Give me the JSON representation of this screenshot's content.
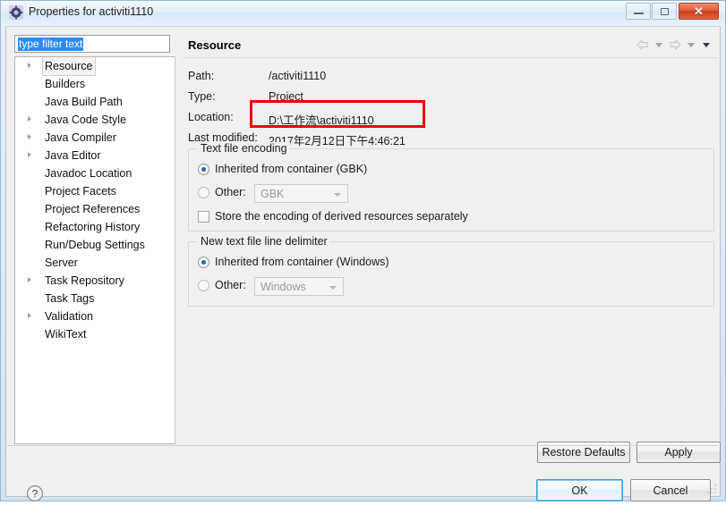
{
  "window": {
    "title": "Properties for activiti1110",
    "icon": "properties-gear-icon",
    "controls": {
      "minimize": "Minimize",
      "maximize": "Maximize",
      "close": "Close"
    }
  },
  "filter": {
    "value": "type filter text",
    "placeholder": "type filter text"
  },
  "tree": {
    "items": [
      {
        "label": "Resource",
        "expandable": true,
        "selected": true
      },
      {
        "label": "Builders",
        "expandable": false,
        "selected": false
      },
      {
        "label": "Java Build Path",
        "expandable": false,
        "selected": false
      },
      {
        "label": "Java Code Style",
        "expandable": true,
        "selected": false
      },
      {
        "label": "Java Compiler",
        "expandable": true,
        "selected": false
      },
      {
        "label": "Java Editor",
        "expandable": true,
        "selected": false
      },
      {
        "label": "Javadoc Location",
        "expandable": false,
        "selected": false
      },
      {
        "label": "Project Facets",
        "expandable": false,
        "selected": false
      },
      {
        "label": "Project References",
        "expandable": false,
        "selected": false
      },
      {
        "label": "Refactoring History",
        "expandable": false,
        "selected": false
      },
      {
        "label": "Run/Debug Settings",
        "expandable": false,
        "selected": false
      },
      {
        "label": "Server",
        "expandable": false,
        "selected": false
      },
      {
        "label": "Task Repository",
        "expandable": true,
        "selected": false
      },
      {
        "label": "Task Tags",
        "expandable": false,
        "selected": false
      },
      {
        "label": "Validation",
        "expandable": true,
        "selected": false
      },
      {
        "label": "WikiText",
        "expandable": false,
        "selected": false
      }
    ]
  },
  "page": {
    "title": "Resource",
    "nav": {
      "back": "back-arrow-icon",
      "back_menu": "back-dropdown-icon",
      "forward": "forward-arrow-icon",
      "forward_menu": "forward-dropdown-icon",
      "view_menu": "view-menu-icon"
    },
    "info": [
      {
        "label": "Path:",
        "value": "/activiti1110"
      },
      {
        "label": "Type:",
        "value": "Project"
      },
      {
        "label": "Location:",
        "value": "D:\\工作流\\activiti1110"
      },
      {
        "label": "Last modified:",
        "value": "2017年2月12日下午4:46:21"
      }
    ],
    "annotation": {
      "color": "#ee0000",
      "target": "Location value"
    },
    "encoding_group": {
      "title": "Text file encoding",
      "inherited": {
        "label": "Inherited from container (GBK)",
        "checked": true
      },
      "other": {
        "label": "Other:",
        "checked": false,
        "value": "GBK",
        "enabled": false
      },
      "store_derived": {
        "label": "Store the encoding of derived resources separately",
        "checked": false
      }
    },
    "delimiter_group": {
      "title": "New text file line delimiter",
      "inherited": {
        "label": "Inherited from container (Windows)",
        "checked": true
      },
      "other": {
        "label": "Other:",
        "checked": false,
        "value": "Windows",
        "enabled": false
      }
    },
    "buttons": {
      "restore_defaults": "Restore Defaults",
      "apply": "Apply"
    }
  },
  "footer": {
    "help": "help-icon",
    "ok": "OK",
    "cancel": "Cancel"
  }
}
